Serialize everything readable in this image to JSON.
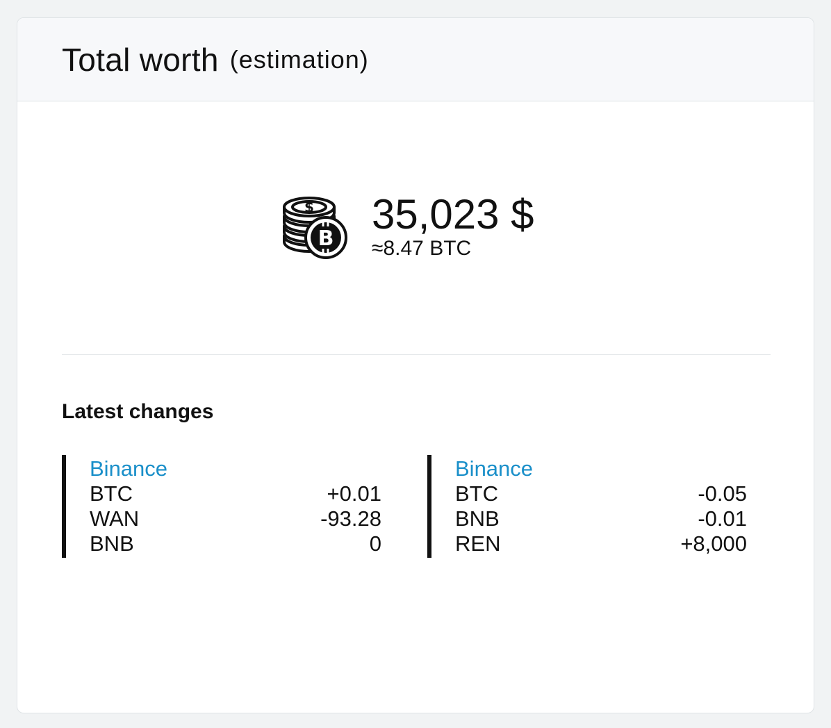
{
  "header": {
    "title": "Total worth",
    "subtitle": "(estimation)"
  },
  "worth": {
    "icon": "coins-bitcoin-icon",
    "value": "35,023 $",
    "btc": "≈8.47 BTC"
  },
  "latest": {
    "title": "Latest changes",
    "groups": [
      {
        "exchange": "Binance",
        "rows": [
          {
            "asset": "BTC",
            "change": "+0.01"
          },
          {
            "asset": "WAN",
            "change": "-93.28"
          },
          {
            "asset": "BNB",
            "change": "0"
          }
        ]
      },
      {
        "exchange": "Binance",
        "rows": [
          {
            "asset": "BTC",
            "change": "-0.05"
          },
          {
            "asset": "BNB",
            "change": "-0.01"
          },
          {
            "asset": "REN",
            "change": "+8,000"
          }
        ]
      }
    ]
  },
  "colors": {
    "exchange_link": "#1a8fc9",
    "group_bar": "#111111",
    "header_bg": "#f7f8fa"
  }
}
